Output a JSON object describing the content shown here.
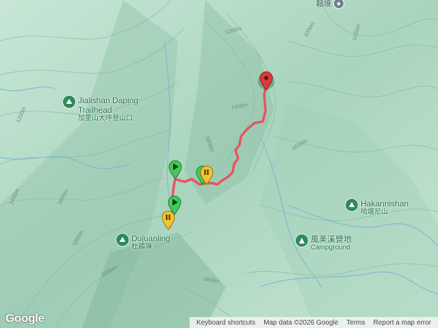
{
  "map": {
    "top_label": "鞍境",
    "pois": [
      {
        "name": "Jialishan Daping Trailhead",
        "line1": "Jialishan Daping",
        "line2": "Trailhead",
        "sub": "加里山大坪登山口",
        "icon": "hiker-icon"
      },
      {
        "name": "Dujuanling",
        "line1": "Dujuanling",
        "sub": "杜鵑嶺",
        "icon": "hiker-icon"
      },
      {
        "name": "Hakannishan",
        "line1": "Hakannishan",
        "sub": "哈堪尼山",
        "icon": "hiker-icon"
      },
      {
        "name": "風美溪營地 Campground",
        "line1": "風美溪營地",
        "sub": "Campground",
        "icon": "campground-icon"
      }
    ],
    "contour_labels": [
      "1200m",
      "1000m",
      "1400m",
      "1600m",
      "1800m",
      "2000m",
      "1400m",
      "1600m",
      "1800m",
      "1200m",
      "1000m",
      "1600m"
    ],
    "route_color": "#e8535f",
    "markers": [
      {
        "type": "end",
        "color": "#d93b3b"
      },
      {
        "type": "start",
        "color": "#43c95a"
      },
      {
        "type": "start",
        "color": "#43c95a"
      },
      {
        "type": "start",
        "color": "#43c95a"
      },
      {
        "type": "pause",
        "color": "#f2c230"
      },
      {
        "type": "pause",
        "color": "#f2c230"
      }
    ]
  },
  "footer": {
    "logo": "Google",
    "keyboard_shortcuts": "Keyboard shortcuts",
    "map_data": "Map data ©2026 Google",
    "terms": "Terms",
    "report": "Report a map error"
  },
  "colors": {
    "terrain": "#bfe0cf",
    "route": "#e8535f",
    "poi": "#2f8a5a"
  }
}
